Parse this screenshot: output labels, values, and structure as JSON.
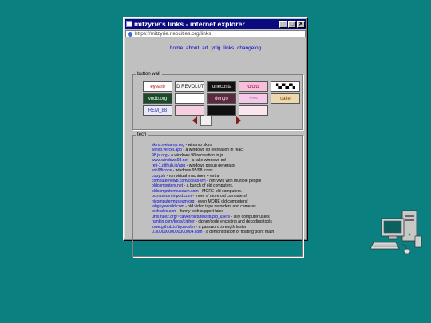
{
  "window": {
    "title": "mitzyrie's links - internet explorer",
    "address": "https://mitzyrie.neocities.org/links",
    "buttons": {
      "minimize": "_",
      "maximize": "□",
      "close": "✕"
    }
  },
  "nav": [
    {
      "label": "home"
    },
    {
      "label": "about"
    },
    {
      "label": "art"
    },
    {
      "label": "ynlg"
    },
    {
      "label": "links"
    },
    {
      "label": "changelog"
    }
  ],
  "button_wall": {
    "legend": "button wall",
    "buttons": [
      {
        "label": "eyearb",
        "bg": "#fff",
        "fg": "#b00000"
      },
      {
        "label": "READ REVOLUTION",
        "bg": "#f4f4f4",
        "fg": "#222"
      },
      {
        "label": "lunecosta",
        "bg": "#111",
        "fg": "#f0f0f0"
      },
      {
        "label": "✿✿✿",
        "bg": "#f6c0d8",
        "fg": "#c04080"
      },
      {
        "label": "▚▞▚▞▚",
        "bg": "#ffffff",
        "fg": "#000"
      },
      {
        "label": "vndb.org",
        "bg": "#1a4a2a",
        "fg": "#e8ffe8"
      },
      {
        "label": "",
        "bg": "#ffffff",
        "fg": "#000"
      },
      {
        "label": "dengo",
        "bg": "#5a2a40",
        "fg": "#ffd0e0"
      },
      {
        "label": "~~~",
        "bg": "#f3c8e8",
        "fg": "#a02080"
      },
      {
        "label": "cake",
        "bg": "#eed8b0",
        "fg": "#8a4000"
      },
      {
        "label": "REM_88",
        "bg": "#e8e8f8",
        "fg": "#3030a0"
      },
      {
        "label": "",
        "bg": "#f6d0e0",
        "fg": "#a02050"
      },
      {
        "label": "",
        "bg": "#111111",
        "fg": "#fff"
      },
      {
        "label": "",
        "bg": "#fbe6ef",
        "fg": "#c02060"
      }
    ]
  },
  "tech": {
    "legend": "tech",
    "links": [
      {
        "link": "skins.webamp.org",
        "desc": " - winamp skins"
      },
      {
        "link": "winxp.vercel.app",
        "desc": " - a windows xp recreation in react"
      },
      {
        "link": "98.js.org",
        "desc": " - a windows 98 recreation in js"
      },
      {
        "link": "www.windows93.net",
        "desc": " - a fake windows os!"
      },
      {
        "link": "refi-1.github.io/app",
        "desc": " - windows popup generator"
      },
      {
        "link": "win98icons",
        "desc": " - windows 95/98 icons"
      },
      {
        "link": "copy.sh",
        "desc": " - run virtual machines + extra"
      },
      {
        "link": "computernewb.com/collab-vm",
        "desc": " - run VMs with multiple people"
      },
      {
        "link": "oldcomputers.net",
        "desc": " - a bunch of old computers."
      },
      {
        "link": "oldcomputermuseum.com",
        "desc": " - MORE old computers."
      },
      {
        "link": "pcmuseum.tripod.com",
        "desc": " - more n' more old computers!"
      },
      {
        "link": "nicomputermuseum.org",
        "desc": " - even MORE old computers!"
      },
      {
        "link": "labguysworld.com",
        "desc": " - old video tape recorders and cameras"
      },
      {
        "link": "techtales.com",
        "desc": " - funny tech support tales"
      },
      {
        "link": "unix.rulez.org/~calver/pictures/stupid_users",
        "desc": " - silly computer users"
      },
      {
        "link": "rumkin.com/tools/cipher",
        "desc": " - cipher/code encoding and decoding tools"
      },
      {
        "link": "lowe.github.io/tryzxcvbn",
        "desc": " - a password strength tester"
      },
      {
        "link": "0.30000000000000004.com",
        "desc": " - a demonstration of floating point math"
      }
    ]
  },
  "desktop": {
    "icon": "computer-icon"
  }
}
